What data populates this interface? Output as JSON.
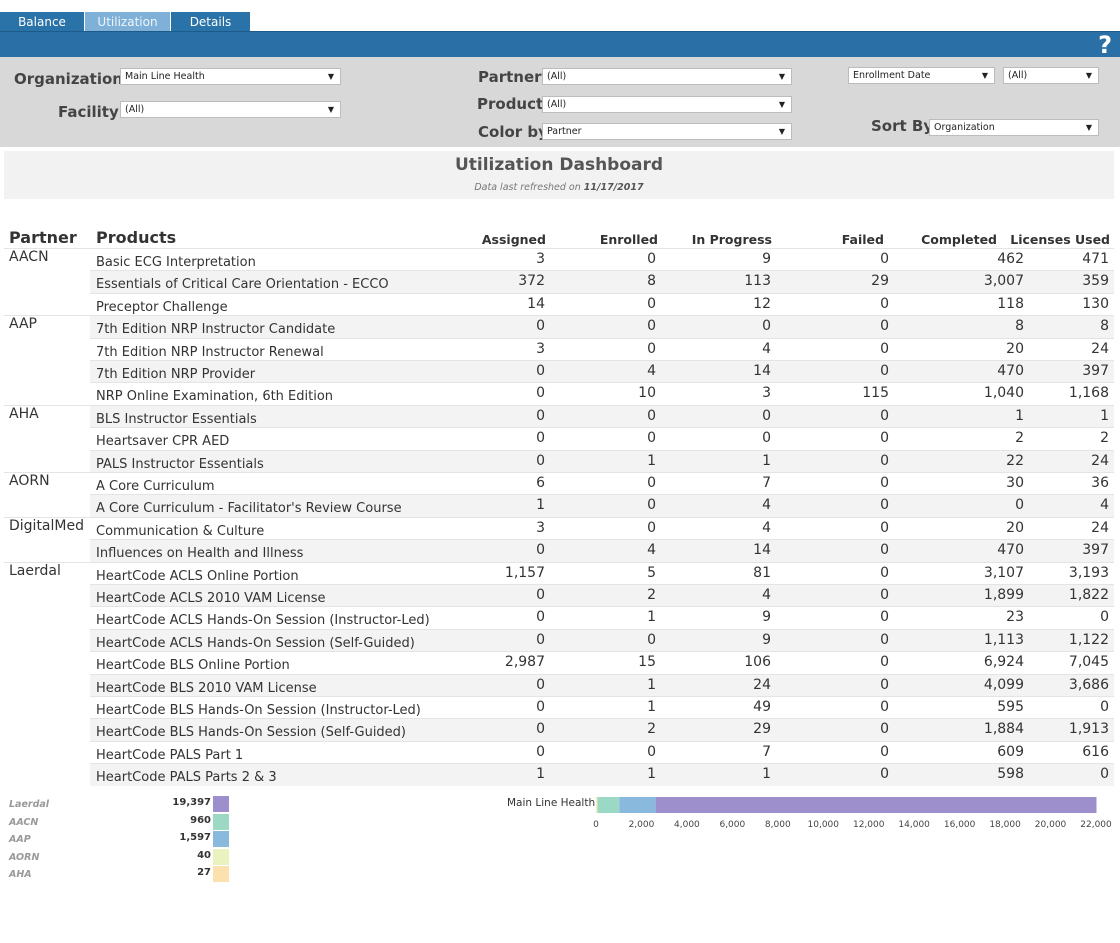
{
  "tabs": [
    {
      "label": "Balance"
    },
    {
      "label": "Utilization"
    },
    {
      "label": "Details"
    }
  ],
  "help_label": "?",
  "filters": {
    "organization": {
      "label": "Organization",
      "value": "Main Line Health"
    },
    "facility": {
      "label": "Facility",
      "value": "(All)"
    },
    "partner": {
      "label": "Partner",
      "value": "(All)"
    },
    "product": {
      "label": "Product",
      "value": "(All)"
    },
    "color_by": {
      "label": "Color by",
      "value": "Partner"
    },
    "date_field": {
      "value": "Enrollment Date"
    },
    "date_value": {
      "value": "(All)"
    },
    "sort_by": {
      "label": "Sort By",
      "value": "Organization"
    }
  },
  "dashboard": {
    "title": "Utilization Dashboard",
    "refresh_prefix": "Data last refreshed on",
    "refresh_date": "11/17/2017"
  },
  "table": {
    "headers": {
      "partner": "Partner",
      "products": "Products",
      "assigned": "Assigned",
      "enrolled": "Enrolled",
      "in_progress": "In Progress",
      "failed": "Failed",
      "completed": "Completed",
      "licenses_used": "Licenses Used"
    },
    "partners": [
      {
        "name": "AACN",
        "rows": [
          {
            "product": "Basic ECG Interpretation",
            "vals": [
              "3",
              "0",
              "9",
              "0",
              "462",
              "471"
            ]
          },
          {
            "product": "Essentials of Critical Care Orientation - ECCO",
            "vals": [
              "372",
              "8",
              "113",
              "29",
              "3,007",
              "359"
            ]
          },
          {
            "product": "Preceptor Challenge",
            "vals": [
              "14",
              "0",
              "12",
              "0",
              "118",
              "130"
            ]
          }
        ]
      },
      {
        "name": "AAP",
        "rows": [
          {
            "product": "7th Edition NRP Instructor Candidate",
            "vals": [
              "0",
              "0",
              "0",
              "0",
              "8",
              "8"
            ]
          },
          {
            "product": "7th Edition NRP Instructor Renewal",
            "vals": [
              "3",
              "0",
              "4",
              "0",
              "20",
              "24"
            ]
          },
          {
            "product": "7th Edition NRP Provider",
            "vals": [
              "0",
              "4",
              "14",
              "0",
              "470",
              "397"
            ]
          },
          {
            "product": "NRP Online Examination, 6th Edition",
            "vals": [
              "0",
              "10",
              "3",
              "115",
              "1,040",
              "1,168"
            ]
          }
        ]
      },
      {
        "name": "AHA",
        "rows": [
          {
            "product": "BLS Instructor Essentials",
            "vals": [
              "0",
              "0",
              "0",
              "0",
              "1",
              "1"
            ]
          },
          {
            "product": "Heartsaver CPR AED",
            "vals": [
              "0",
              "0",
              "0",
              "0",
              "2",
              "2"
            ]
          },
          {
            "product": "PALS Instructor Essentials",
            "vals": [
              "0",
              "1",
              "1",
              "0",
              "22",
              "24"
            ]
          }
        ]
      },
      {
        "name": "AORN",
        "rows": [
          {
            "product": "A Core Curriculum",
            "vals": [
              "6",
              "0",
              "7",
              "0",
              "30",
              "36"
            ]
          },
          {
            "product": "A Core Curriculum - Facilitator's Review Course",
            "vals": [
              "1",
              "0",
              "4",
              "0",
              "0",
              "4"
            ]
          }
        ]
      },
      {
        "name": "DigitalMed",
        "rows": [
          {
            "product": "Communication & Culture",
            "vals": [
              "3",
              "0",
              "4",
              "0",
              "20",
              "24"
            ]
          },
          {
            "product": "Influences on Health and Illness",
            "vals": [
              "0",
              "4",
              "14",
              "0",
              "470",
              "397"
            ]
          }
        ]
      },
      {
        "name": "Laerdal",
        "rows": [
          {
            "product": "HeartCode ACLS Online Portion",
            "vals": [
              "1,157",
              "5",
              "81",
              "0",
              "3,107",
              "3,193"
            ]
          },
          {
            "product": "HeartCode ACLS 2010 VAM License",
            "vals": [
              "0",
              "2",
              "4",
              "0",
              "1,899",
              "1,822"
            ]
          },
          {
            "product": "HeartCode ACLS Hands-On Session (Instructor-Led)",
            "vals": [
              "0",
              "1",
              "9",
              "0",
              "23",
              "0"
            ]
          },
          {
            "product": "HeartCode ACLS Hands-On Session (Self-Guided)",
            "vals": [
              "0",
              "0",
              "9",
              "0",
              "1,113",
              "1,122"
            ]
          },
          {
            "product": "HeartCode BLS Online Portion",
            "vals": [
              "2,987",
              "15",
              "106",
              "0",
              "6,924",
              "7,045"
            ]
          },
          {
            "product": "HeartCode BLS 2010 VAM License",
            "vals": [
              "0",
              "1",
              "24",
              "0",
              "4,099",
              "3,686"
            ]
          },
          {
            "product": "HeartCode BLS Hands-On Session (Instructor-Led)",
            "vals": [
              "0",
              "1",
              "49",
              "0",
              "595",
              "0"
            ]
          },
          {
            "product": "HeartCode BLS Hands-On Session (Self-Guided)",
            "vals": [
              "0",
              "2",
              "29",
              "0",
              "1,884",
              "1,913"
            ]
          },
          {
            "product": "HeartCode PALS Part 1",
            "vals": [
              "0",
              "0",
              "7",
              "0",
              "609",
              "616"
            ]
          },
          {
            "product": "HeartCode PALS Parts 2 & 3",
            "vals": [
              "1",
              "1",
              "1",
              "0",
              "598",
              "0"
            ]
          }
        ]
      }
    ]
  },
  "legend": [
    {
      "name": "Laerdal",
      "value": "19,397",
      "color": "#9d8fcb"
    },
    {
      "name": "AACN",
      "value": "960",
      "color": "#9cd9c4"
    },
    {
      "name": "AAP",
      "value": "1,597",
      "color": "#89b9dd"
    },
    {
      "name": "AORN",
      "value": "40",
      "color": "#eaf3c0"
    },
    {
      "name": "AHA",
      "value": "27",
      "color": "#fbe1ae"
    }
  ],
  "chart_data": {
    "type": "bar",
    "orientation": "horizontal-stacked",
    "categories": [
      "Main Line Health"
    ],
    "series": [
      {
        "name": "AHA",
        "values": [
          27
        ],
        "color": "#fbe1ae"
      },
      {
        "name": "AORN",
        "values": [
          40
        ],
        "color": "#eaf3c0"
      },
      {
        "name": "AACN",
        "values": [
          960
        ],
        "color": "#9cd9c4"
      },
      {
        "name": "AAP",
        "values": [
          1597
        ],
        "color": "#89b9dd"
      },
      {
        "name": "Laerdal",
        "values": [
          19397
        ],
        "color": "#9d8fcb"
      }
    ],
    "xlim": [
      0,
      22000
    ],
    "xticks": [
      "0",
      "2,000",
      "4,000",
      "6,000",
      "8,000",
      "10,000",
      "12,000",
      "14,000",
      "16,000",
      "18,000",
      "20,000",
      "22,000"
    ]
  }
}
